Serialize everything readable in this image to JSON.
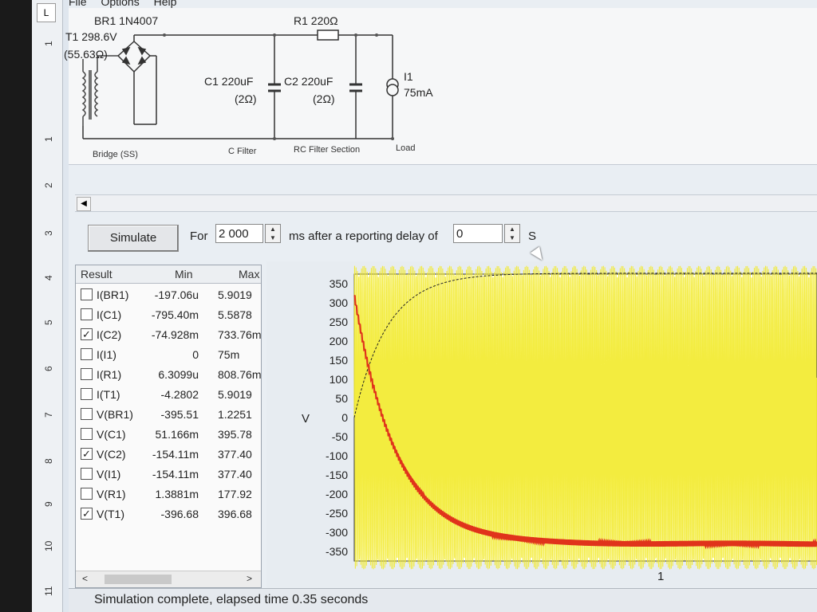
{
  "menu": [
    "File",
    "Options",
    "Help"
  ],
  "ruler": {
    "corner": "L",
    "ticks": [
      "1",
      "1",
      "2",
      "3",
      "4",
      "5",
      "6",
      "7",
      "8",
      "9",
      "10",
      "11"
    ]
  },
  "schematic": {
    "bridge_label": "BR1 1N4007",
    "transformer_label": "T1 298.6V",
    "transformer_res": "(55.63Ω)",
    "r1_label": "R1 220Ω",
    "c1_label": "C1 220uF",
    "c1_res": "(2Ω)",
    "c2_label": "C2 220uF",
    "c2_res": "(2Ω)",
    "i1_label": "I1",
    "i1_value": "75mA",
    "sections": [
      "Bridge (SS)",
      "C Filter",
      "RC Filter Section",
      "Load"
    ]
  },
  "controls": {
    "simulate_label": "Simulate",
    "for_label": "For",
    "duration_value": "2 000",
    "ms_label": "ms  after a reporting delay of",
    "delay_value": "0",
    "s_label": "S"
  },
  "results": {
    "headers": {
      "result": "Result",
      "min": "Min",
      "max": "Max"
    },
    "rows": [
      {
        "name": "I(BR1)",
        "min": "-197.06u",
        "max": "5.9019",
        "checked": false
      },
      {
        "name": "I(C1)",
        "min": "-795.40m",
        "max": "5.5878",
        "checked": false
      },
      {
        "name": "I(C2)",
        "min": "-74.928m",
        "max": "733.76m",
        "checked": true
      },
      {
        "name": "I(I1)",
        "min": "0",
        "max": "75m",
        "checked": false
      },
      {
        "name": "I(R1)",
        "min": "6.3099u",
        "max": "808.76m",
        "checked": false
      },
      {
        "name": "I(T1)",
        "min": "-4.2802",
        "max": "5.9019",
        "checked": false
      },
      {
        "name": "V(BR1)",
        "min": "-395.51",
        "max": "1.2251",
        "checked": false
      },
      {
        "name": "V(C1)",
        "min": "51.166m",
        "max": "395.78",
        "checked": false
      },
      {
        "name": "V(C2)",
        "min": "-154.11m",
        "max": "377.40",
        "checked": true
      },
      {
        "name": "V(I1)",
        "min": "-154.11m",
        "max": "377.40",
        "checked": false
      },
      {
        "name": "V(R1)",
        "min": "1.3881m",
        "max": "177.92",
        "checked": false
      },
      {
        "name": "V(T1)",
        "min": "-396.68",
        "max": "396.68",
        "checked": true
      }
    ]
  },
  "chart_data": {
    "type": "line",
    "ylabel": "V",
    "ylim": [
      -375,
      375
    ],
    "yticks": [
      350,
      300,
      250,
      200,
      150,
      100,
      50,
      0,
      -50,
      -100,
      -150,
      -200,
      -250,
      -300,
      -350
    ],
    "xticks": [
      "1"
    ],
    "series": [
      {
        "color": "#f2ea2a",
        "description": "V(T1) dense sinusoid ±397"
      },
      {
        "color": "#222222",
        "description": "V(C2) charging curve to ~377"
      },
      {
        "color": "#e0331b",
        "description": "I(C2) decaying spikes"
      }
    ]
  },
  "status": "Simulation complete, elapsed time 0.35 seconds",
  "colors": {
    "trace_yellow": "#f2ea2a",
    "trace_red": "#e0331b",
    "plot_bg": "#ffffff"
  }
}
